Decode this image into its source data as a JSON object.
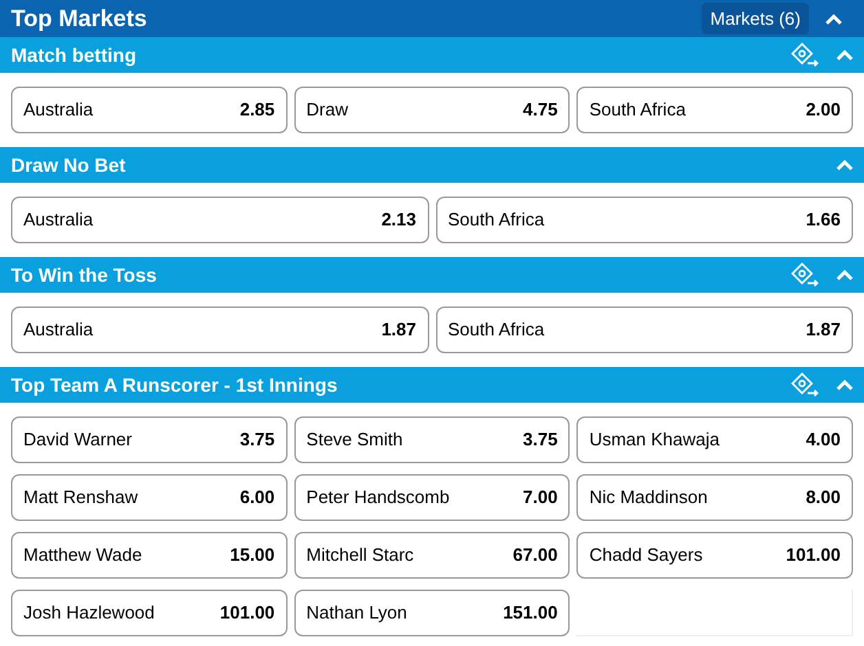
{
  "header": {
    "title": "Top Markets",
    "badge": "Markets (6)",
    "expanded": true
  },
  "markets": [
    {
      "title": "Match betting",
      "cash_out": true,
      "expanded": true,
      "outcomes": [
        {
          "name": "Australia",
          "odds": "2.85"
        },
        {
          "name": "Draw",
          "odds": "4.75"
        },
        {
          "name": "South Africa",
          "odds": "2.00"
        }
      ]
    },
    {
      "title": "Draw No Bet",
      "cash_out": false,
      "expanded": true,
      "outcomes": [
        {
          "name": "Australia",
          "odds": "2.13"
        },
        {
          "name": "South Africa",
          "odds": "1.66"
        }
      ]
    },
    {
      "title": "To Win the Toss",
      "cash_out": true,
      "expanded": true,
      "outcomes": [
        {
          "name": "Australia",
          "odds": "1.87"
        },
        {
          "name": "South Africa",
          "odds": "1.87"
        }
      ]
    },
    {
      "title": "Top Team A Runscorer - 1st Innings",
      "cash_out": true,
      "expanded": true,
      "outcomes": [
        {
          "name": "David Warner",
          "odds": "3.75"
        },
        {
          "name": "Steve Smith",
          "odds": "3.75"
        },
        {
          "name": "Usman Khawaja",
          "odds": "4.00"
        },
        {
          "name": "Matt Renshaw",
          "odds": "6.00"
        },
        {
          "name": "Peter Handscomb",
          "odds": "7.00"
        },
        {
          "name": "Nic Maddinson",
          "odds": "8.00"
        },
        {
          "name": "Matthew Wade",
          "odds": "15.00"
        },
        {
          "name": "Mitchell Starc",
          "odds": "67.00"
        },
        {
          "name": "Chadd Sayers",
          "odds": "101.00"
        },
        {
          "name": "Josh Hazlewood",
          "odds": "101.00"
        },
        {
          "name": "Nathan Lyon",
          "odds": "151.00"
        }
      ]
    }
  ]
}
